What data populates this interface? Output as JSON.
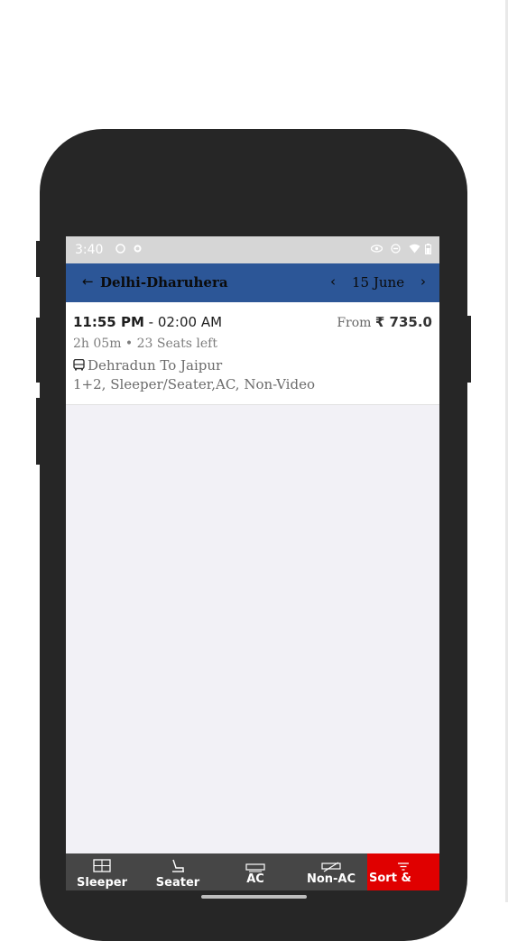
{
  "status_bar": {
    "time": "3:40",
    "left_icons": [
      "notification-icon",
      "settings-icon"
    ],
    "right_icons": [
      "eye-icon",
      "dnd-icon",
      "wifi-icon",
      "battery-icon"
    ]
  },
  "header": {
    "route": "Delhi-Dharuhera",
    "date": "15 June",
    "bg_color": "#2c5697"
  },
  "results": [
    {
      "depart": "11:55 PM",
      "arrive_text": " - 02:00 AM",
      "from_label": "From",
      "price": "₹ 735.0",
      "meta": "2h 05m • 23 Seats left",
      "operator_route": "Dehradun To Jaipur",
      "features": "1+2, Sleeper/Seater,AC, Non-Video"
    }
  ],
  "bottom_filters": [
    {
      "label": "Sleeper",
      "icon": "sleeper-icon"
    },
    {
      "label": "Seater",
      "icon": "seater-icon"
    },
    {
      "label": "AC",
      "icon": "ac-icon"
    },
    {
      "label": "Non-AC",
      "icon": "non-ac-icon"
    }
  ],
  "sort_filter": {
    "label": "Sort &",
    "icon": "filter-icon",
    "color": "#e00000"
  }
}
